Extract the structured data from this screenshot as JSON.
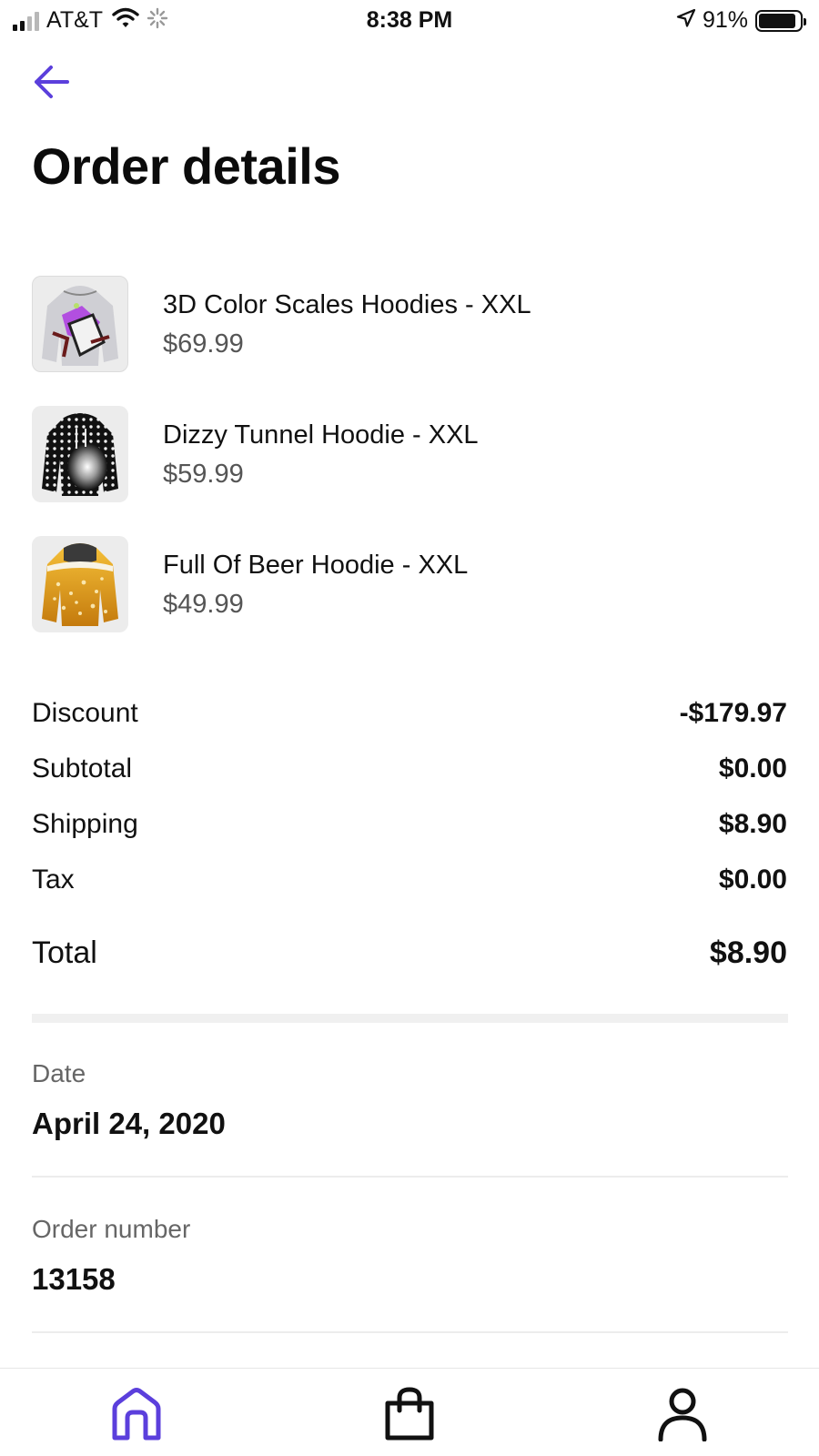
{
  "status_bar": {
    "carrier": "AT&T",
    "time": "8:38 PM",
    "battery_percent": "91%"
  },
  "header": {
    "title": "Order details"
  },
  "items": [
    {
      "name": "3D Color Scales Hoodies - XXL",
      "price": "$69.99",
      "image": "hoodie-color-scales"
    },
    {
      "name": "Dizzy Tunnel Hoodie - XXL",
      "price": "$59.99",
      "image": "hoodie-dizzy-tunnel"
    },
    {
      "name": "Full Of Beer Hoodie - XXL",
      "price": "$49.99",
      "image": "hoodie-full-of-beer"
    }
  ],
  "summary": {
    "discount_label": "Discount",
    "discount_value": "-$179.97",
    "subtotal_label": "Subtotal",
    "subtotal_value": "$0.00",
    "shipping_label": "Shipping",
    "shipping_value": "$8.90",
    "tax_label": "Tax",
    "tax_value": "$0.00",
    "total_label": "Total",
    "total_value": "$8.90"
  },
  "details": {
    "date_label": "Date",
    "date_value": "April 24, 2020",
    "order_number_label": "Order number",
    "order_number_value": "13158"
  },
  "bottom_nav": {
    "items": [
      "home-icon",
      "shopping-bag-icon",
      "profile-icon"
    ],
    "active": "home-icon"
  },
  "colors": {
    "accent": "#5b3fdc",
    "text_primary": "#111111",
    "text_secondary": "#555555",
    "divider": "#ececec"
  }
}
